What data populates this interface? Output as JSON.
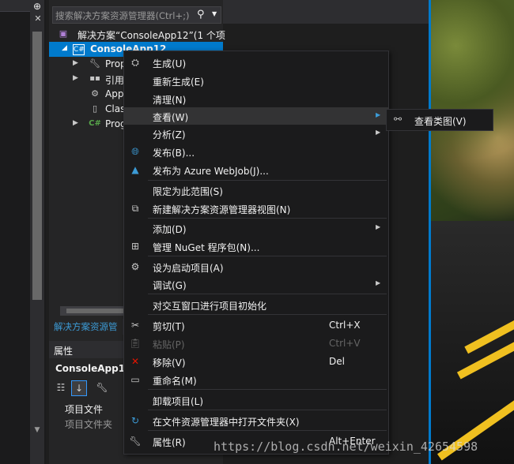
{
  "search": {
    "placeholder": "搜索解决方案资源管理器(Ctrl+;)"
  },
  "tree": {
    "solution": "解决方案“ConsoleApp12”(1 个项",
    "project": "ConsoleApp12",
    "items": [
      {
        "label": "Prop",
        "icon": "wrench-icon",
        "expandable": true
      },
      {
        "label": "引用",
        "icon": "references-icon",
        "expandable": true
      },
      {
        "label": "App",
        "icon": "config-file-icon",
        "expandable": false
      },
      {
        "label": "Clas",
        "icon": "class-file-icon",
        "expandable": false
      },
      {
        "label": "Prog",
        "icon": "csharp-file-icon",
        "expandable": true
      }
    ]
  },
  "explorer_tab": "解决方案资源管",
  "properties": {
    "title": "属性",
    "object": "ConsoleApp12",
    "category": "项目文件",
    "row": "项目文件夹"
  },
  "menu": {
    "items": [
      {
        "label": "生成(U)",
        "icon": "build-icon"
      },
      {
        "label": "重新生成(E)",
        "icon": ""
      },
      {
        "label": "清理(N)",
        "icon": ""
      },
      {
        "label": "查看(W)",
        "icon": "",
        "submenu": true
      },
      {
        "label": "分析(Z)",
        "icon": "",
        "submenu": true
      },
      {
        "label": "发布(B)...",
        "icon": "globe-icon"
      },
      {
        "label": "发布为 Azure WebJob(J)...",
        "icon": "azure-icon"
      },
      {
        "label": "限定为此范围(S)",
        "icon": ""
      },
      {
        "label": "新建解决方案资源管理器视图(N)",
        "icon": "new-view-icon"
      },
      {
        "label": "添加(D)",
        "icon": "",
        "submenu": true
      },
      {
        "label": "管理 NuGet 程序包(N)...",
        "icon": "nuget-icon"
      },
      {
        "label": "设为启动项目(A)",
        "icon": "gear-icon"
      },
      {
        "label": "调试(G)",
        "icon": "",
        "submenu": true
      },
      {
        "label": "对交互窗口进行项目初始化",
        "icon": ""
      },
      {
        "label": "剪切(T)",
        "icon": "scissors-icon",
        "shortcut": "Ctrl+X"
      },
      {
        "label": "粘贴(P)",
        "icon": "paste-icon",
        "shortcut": "Ctrl+V",
        "disabled": true
      },
      {
        "label": "移除(V)",
        "icon": "remove-icon",
        "shortcut": "Del"
      },
      {
        "label": "重命名(M)",
        "icon": "rename-icon"
      },
      {
        "label": "卸载项目(L)",
        "icon": ""
      },
      {
        "label": "在文件资源管理器中打开文件夹(X)",
        "icon": "refresh-icon"
      },
      {
        "label": "属性(R)",
        "icon": "wrench-icon",
        "shortcut": "Alt+Enter"
      }
    ],
    "submenu": {
      "label": "查看类图(V)",
      "icon": "class-diagram-icon"
    }
  },
  "watermark": "https://blog.csdn.net/weixin_42654598",
  "colors": {
    "accent": "#007acc",
    "menu_bg": "#1b1b1c",
    "highlight": "#333334",
    "link": "#3c9bd6",
    "remove": "#e51400"
  }
}
